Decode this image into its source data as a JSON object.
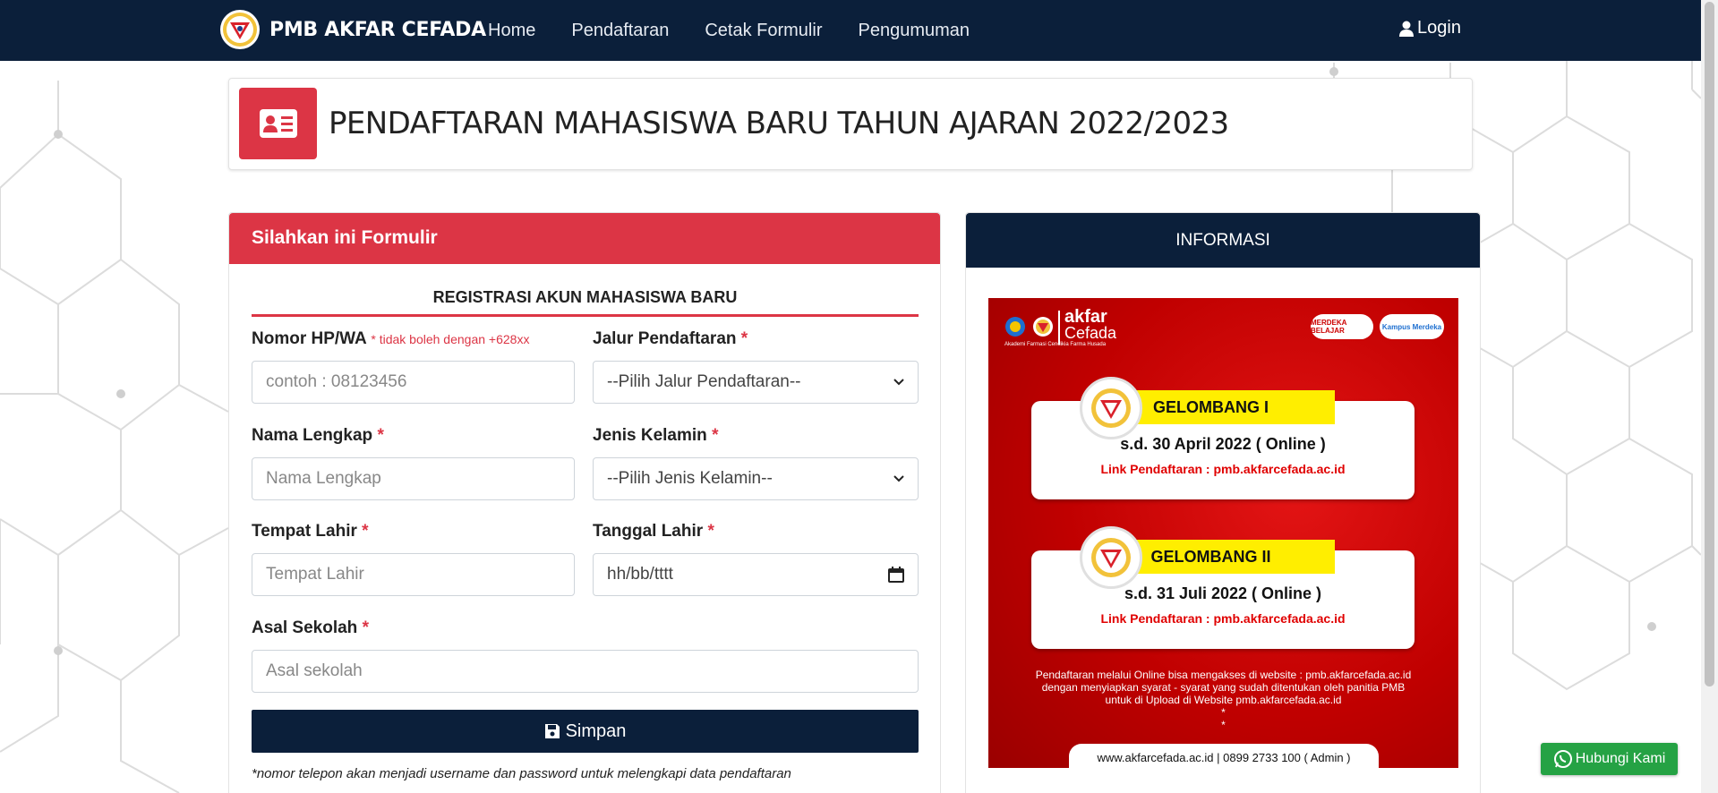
{
  "navbar": {
    "brand": "PMB AKFAR CEFADA",
    "links": [
      "Home",
      "Pendaftaran",
      "Cetak Formulir",
      "Pengumuman"
    ],
    "login": "Login",
    "bg_color": "#0b1f3a"
  },
  "title_card": {
    "title": "PENDAFTARAN MAHASISWA BARU TAHUN AJARAN 2022/2023",
    "icon": "id-card-icon",
    "accent": "#dc3545"
  },
  "form": {
    "header": "Silahkan ini Formulir",
    "subtitle": "REGISTRASI AKUN MAHASISWA BARU",
    "phone": {
      "label": "Nomor HP/WA",
      "hint": "* tidak boleh dengan +628xx",
      "placeholder": "contoh : 08123456"
    },
    "jalur": {
      "label": "Jalur Pendaftaran",
      "required": "*",
      "value": "--Pilih Jalur Pendaftaran--"
    },
    "nama": {
      "label": "Nama Lengkap",
      "required": "*",
      "placeholder": "Nama Lengkap"
    },
    "kelamin": {
      "label": "Jenis Kelamin",
      "required": "*",
      "value": "--Pilih Jenis Kelamin--"
    },
    "tempat": {
      "label": "Tempat Lahir",
      "required": "*",
      "placeholder": "Tempat Lahir"
    },
    "tanggal": {
      "label": "Tanggal Lahir",
      "required": "*",
      "placeholder": "hh/bb/tttt"
    },
    "sekolah": {
      "label": "Asal Sekolah",
      "required": "*",
      "placeholder": "Asal sekolah"
    },
    "save": "Simpan",
    "footnote": "*nomor telepon akan menjadi username dan password untuk melengkapi data pendaftaran"
  },
  "info": {
    "header": "INFORMASI",
    "banner": {
      "logo_title": "akfar",
      "logo_sub": "Cefada",
      "logo_caption": "Akademi Farmasi Cendikia Farma Husada",
      "pill_1": "MERDEKA BELAJAR",
      "pill_2": "Kampus Merdeka",
      "waves": [
        {
          "name": "GELOMBANG I",
          "date": "s.d. 30 April 2022 ( Online )",
          "link": "Link Pendaftaran : pmb.akfarcefada.ac.id"
        },
        {
          "name": "GELOMBANG II",
          "date": "s.d. 31 Juli 2022 ( Online )",
          "link": "Link Pendaftaran : pmb.akfarcefada.ac.id"
        }
      ],
      "note_1": "Pendaftaran melalui Online bisa mengakses di website : pmb.akfarcefada.ac.id",
      "note_2": "dengan menyiapkan syarat - syarat yang sudah ditentukan oleh panitia PMB",
      "note_3": "untuk di Upload di Website pmb.akfarcefada.ac.id",
      "note_4": "*",
      "note_5": "*",
      "footer": "www.akfarcefada.ac.id | 0899 2733 100 ( Admin )"
    }
  },
  "whatsapp": {
    "label": "Hubungi Kami",
    "color": "#25a244"
  }
}
